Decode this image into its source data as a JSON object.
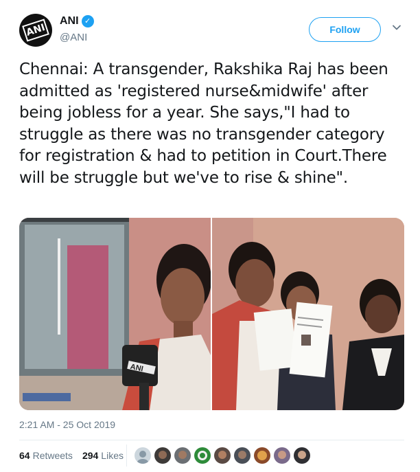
{
  "account": {
    "name": "ANI",
    "handle": "@ANI",
    "verified": true,
    "logo_text": "ANI"
  },
  "follow_button": {
    "label": "Follow"
  },
  "menu": {
    "icon": "chevron-down-icon"
  },
  "tweet": {
    "text": "Chennai: A transgender, Rakshika Raj has been admitted as 'registered nurse&midwife' after being jobless for a year. She says,\"I had to struggle as there was no transgender category for registration & had to petition in Court.There will be struggle but we've to rise & shine\".",
    "timestamp": "2:21 AM - 25 Oct 2019"
  },
  "media": {
    "mic_label": "ANI"
  },
  "stats": {
    "retweets_count": "64",
    "retweets_label": "Retweets",
    "likes_count": "294",
    "likes_label": "Likes"
  },
  "colors": {
    "brand_blue": "#1da1f2",
    "secondary_text": "#657786",
    "primary_text": "#14171a"
  }
}
